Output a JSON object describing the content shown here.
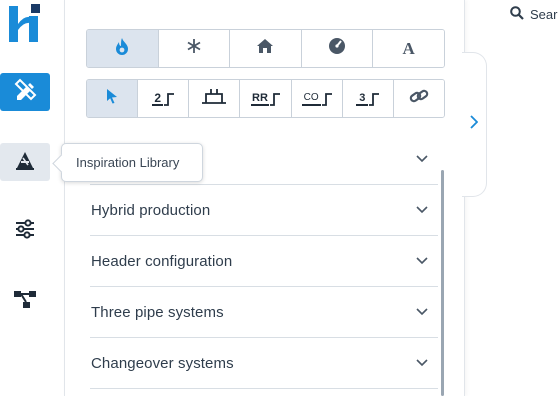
{
  "rail": {
    "items": [
      {
        "name": "logo",
        "icon": "h-logo"
      },
      {
        "name": "design-tool",
        "icon": "pencil-ruler-icon"
      },
      {
        "name": "inspiration-library",
        "icon": "inspiration-icon"
      },
      {
        "name": "settings",
        "icon": "sliders-icon"
      },
      {
        "name": "schematic",
        "icon": "hierarchy-icon"
      }
    ]
  },
  "tooltip": {
    "text": "Inspiration Library"
  },
  "toolbar_top": {
    "buttons": [
      {
        "icon": "flame-icon",
        "selected": true
      },
      {
        "icon": "snowflake-icon",
        "selected": false
      },
      {
        "icon": "house-icon",
        "selected": false
      },
      {
        "icon": "gauge-icon",
        "selected": false
      },
      {
        "icon": "letter-a-icon",
        "text": "A",
        "selected": false
      }
    ]
  },
  "toolbar_bottom": {
    "buttons": [
      {
        "icon": "cursor-icon",
        "selected": true
      },
      {
        "icon": "two-pipe-icon",
        "text": "2",
        "selected": false
      },
      {
        "icon": "tank-icon",
        "selected": false
      },
      {
        "icon": "rr-icon",
        "text": "RR",
        "selected": false
      },
      {
        "icon": "co-icon",
        "text": "CO",
        "selected": false
      },
      {
        "icon": "three-pipe-icon",
        "text": "3",
        "selected": false
      },
      {
        "icon": "link-icon",
        "selected": false
      }
    ]
  },
  "library": {
    "sections": [
      {
        "label": ""
      },
      {
        "label": "Hybrid production"
      },
      {
        "label": "Header configuration"
      },
      {
        "label": "Three pipe systems"
      },
      {
        "label": "Changeover systems"
      }
    ]
  },
  "search": {
    "label": "Sear"
  },
  "colors": {
    "brand": "#1a8bd8",
    "selected": "#dce4ee",
    "icon": "#4a5766"
  }
}
